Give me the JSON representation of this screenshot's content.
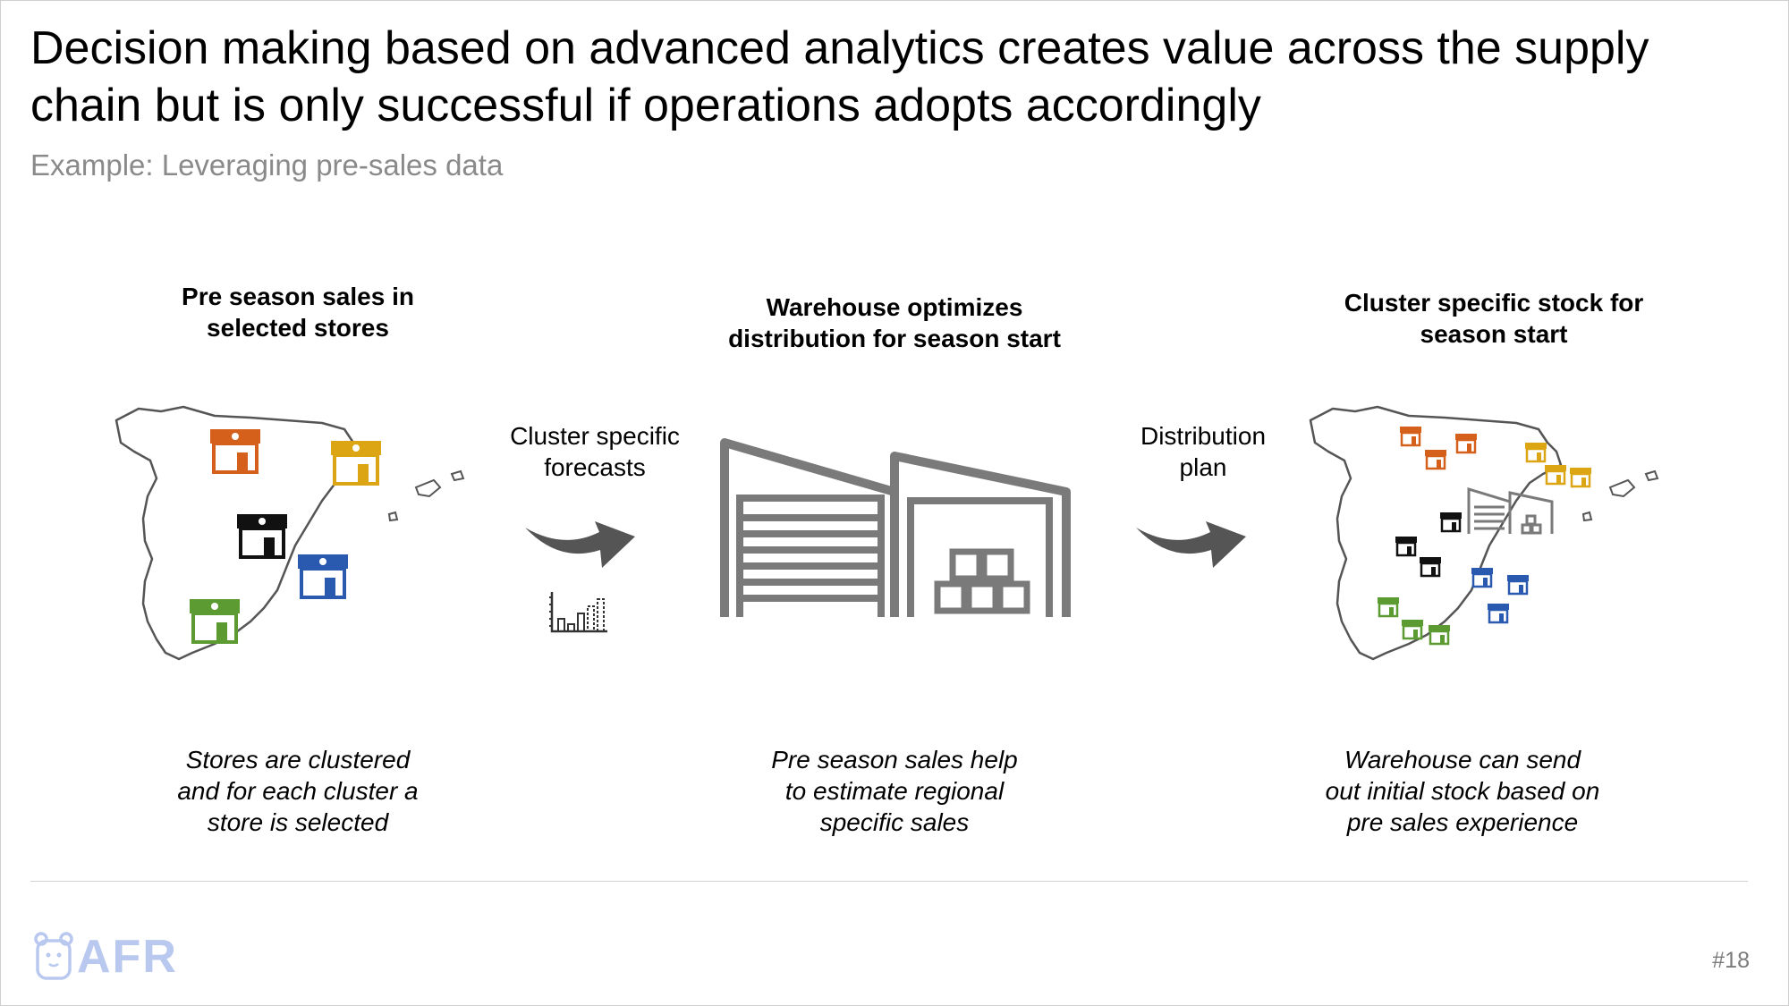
{
  "title": {
    "line1": "Decision making based on advanced analytics creates value across the supply",
    "line2": "chain but is only successful if operations adopts accordingly"
  },
  "subtitle": "Example: Leveraging pre-sales data",
  "steps": [
    {
      "heading": [
        "Pre season sales in",
        "selected stores"
      ],
      "caption": [
        "Stores are clustered",
        "and for each cluster a",
        "store is selected"
      ]
    },
    {
      "heading": [
        "Warehouse optimizes",
        "distribution for season start"
      ],
      "caption": [
        "Pre season sales help",
        "to estimate regional",
        "specific sales"
      ]
    },
    {
      "heading": [
        "Cluster specific stock for",
        "season start"
      ],
      "caption": [
        "Warehouse can send",
        "out initial stock based on",
        "pre sales experience"
      ]
    }
  ],
  "arrows": [
    {
      "label": [
        "Cluster specific",
        "forecasts"
      ]
    },
    {
      "label": [
        "Distribution",
        "plan"
      ]
    }
  ],
  "colors": {
    "orange": "#d4601c",
    "yellow": "#dba514",
    "black": "#111111",
    "blue": "#2a59b0",
    "green": "#5c9a32",
    "gray": "#7a7a7a",
    "logo": "#b9c8ef"
  },
  "icons": [
    "spain-map",
    "store-icon",
    "warehouse-icon",
    "curved-arrow-icon",
    "bar-chart-icon",
    "bear-logo-icon"
  ],
  "footer": {
    "logo_text": "AFR",
    "page_number": "#18"
  }
}
